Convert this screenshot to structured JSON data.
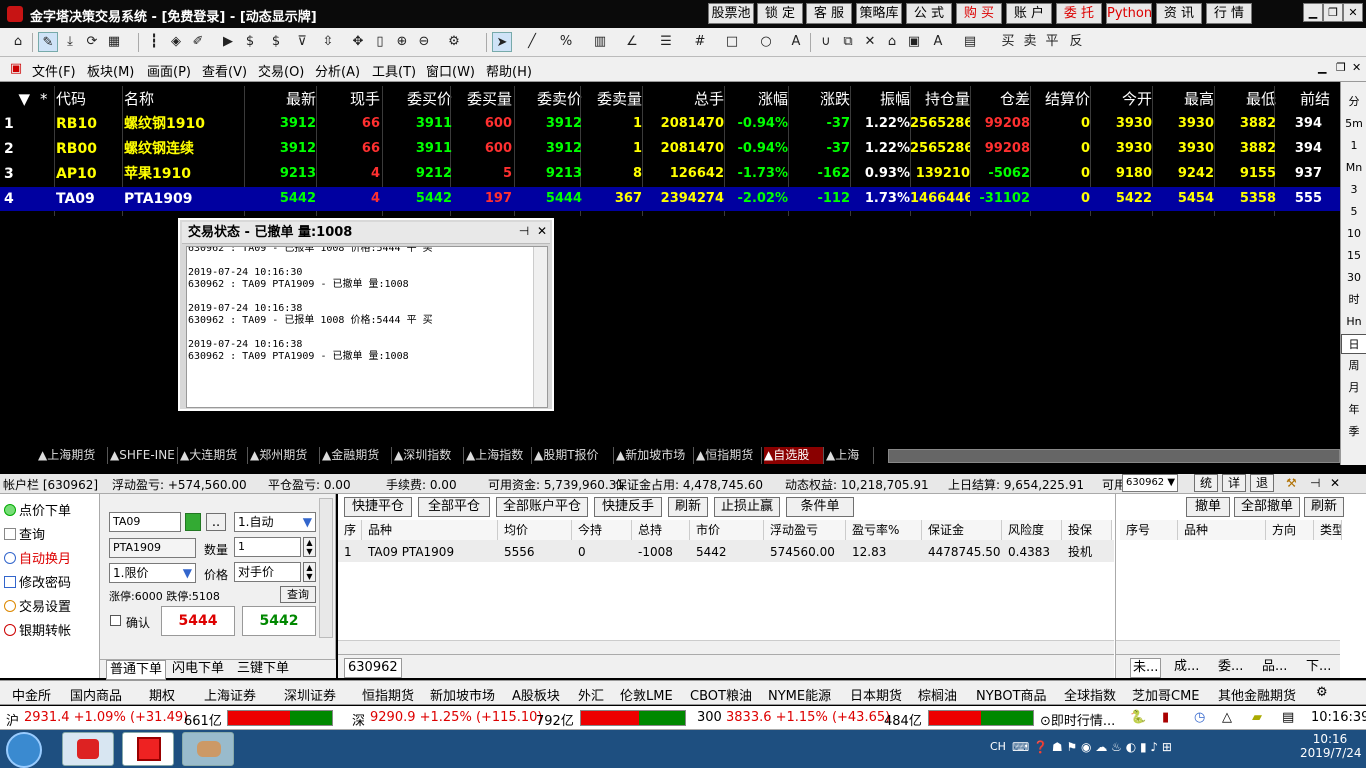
{
  "title": {
    "app": "金字塔决策交易系统",
    "login": "[免费登录]",
    "mode": "[动态显示牌]"
  },
  "title_buttons": [
    {
      "label": "股票池",
      "red": false
    },
    {
      "label": "锁 定",
      "red": false
    },
    {
      "label": "客 服",
      "red": false
    },
    {
      "label": "策略库",
      "red": false
    },
    {
      "label": "公 式",
      "red": false
    },
    {
      "label": "购 买",
      "red": true
    },
    {
      "label": "账 户",
      "red": false
    },
    {
      "label": "委 托",
      "red": true
    },
    {
      "label": "Python",
      "red": true
    },
    {
      "label": "资 讯",
      "red": false
    },
    {
      "label": "行 情",
      "red": false
    }
  ],
  "menu": [
    "文件(F)",
    "板块(M)",
    "画面(P)",
    "查看(V)",
    "交易(O)",
    "分析(A)",
    "工具(T)",
    "窗口(W)",
    "帮助(H)"
  ],
  "quote_headers": [
    "*",
    "代码",
    "名称",
    "最新",
    "现手",
    "委买价",
    "委买量",
    "委卖价",
    "委卖量",
    "总手",
    "涨幅",
    "涨跌",
    "振幅",
    "持仓量",
    "仓差",
    "结算价",
    "今开",
    "最高",
    "最低",
    "前结"
  ],
  "quote_rows": [
    {
      "no": "1",
      "code": "RB10",
      "name": "螺纹钢1910",
      "last": "3912",
      "vol": "66",
      "bid": "3911",
      "bidv": "600",
      "ask": "3912",
      "askv": "1",
      "total": "2081470",
      "chg": "-0.94%",
      "diff": "-37",
      "amp": "1.22%",
      "oi": "2565286",
      "oid": "99208",
      "settle": "0",
      "open": "3930",
      "high": "3930",
      "low": "3882",
      "pre": "394"
    },
    {
      "no": "2",
      "code": "RB00",
      "name": "螺纹钢连续",
      "last": "3912",
      "vol": "66",
      "bid": "3911",
      "bidv": "600",
      "ask": "3912",
      "askv": "1",
      "total": "2081470",
      "chg": "-0.94%",
      "diff": "-37",
      "amp": "1.22%",
      "oi": "2565286",
      "oid": "99208",
      "settle": "0",
      "open": "3930",
      "high": "3930",
      "low": "3882",
      "pre": "394"
    },
    {
      "no": "3",
      "code": "AP10",
      "name": "苹果1910",
      "last": "9213",
      "vol": "4",
      "bid": "9212",
      "bidv": "5",
      "ask": "9213",
      "askv": "8",
      "total": "126642",
      "chg": "-1.73%",
      "diff": "-162",
      "amp": "0.93%",
      "oi": "139210",
      "oid": "-5062",
      "settle": "0",
      "open": "9180",
      "high": "9242",
      "low": "9155",
      "pre": "937"
    },
    {
      "no": "4",
      "code": "TA09",
      "name": "PTA1909",
      "last": "5442",
      "vol": "4",
      "bid": "5442",
      "bidv": "197",
      "ask": "5444",
      "askv": "367",
      "total": "2394274",
      "chg": "-2.02%",
      "diff": "-112",
      "amp": "1.73%",
      "oi": "1466446",
      "oid": "-31102",
      "settle": "0",
      "open": "5422",
      "high": "5454",
      "low": "5358",
      "pre": "555"
    }
  ],
  "popup": {
    "title": "交易状态 - 已撤单 量:1008",
    "log": "630962 : TA09 - 已报单 1008 价格:5444 平 买\n\n2019-07-24 10:16:30\n630962 : TA09 PTA1909 - 已撤单 量:1008\n\n2019-07-24 10:16:38\n630962 : TA09 - 已报单 1008 价格:5444 平 买\n\n2019-07-24 10:16:38\n630962 : TA09 PTA1909 - 已撤单 量:1008"
  },
  "tabs": [
    "▲上海期货",
    "▲SHFE-INE",
    "▲大连期货",
    "▲郑州期货",
    "▲金融期货",
    "▲深圳指数",
    "▲上海指数",
    "▲股期T报价",
    "▲新加坡市场",
    "▲恒指期货",
    "▲自选股",
    "▲上海"
  ],
  "right_side": [
    "分",
    "5m",
    "1",
    "Mn",
    "3",
    "5",
    "10",
    "15",
    "30",
    "时",
    "Hn",
    "日",
    "周",
    "月",
    "年",
    "季"
  ],
  "account": {
    "label": "帐户栏",
    "id": "[630962]",
    "float": "浮动盈亏: +574,560.00",
    "close": "平仓盈亏: 0.00",
    "fee": "手续费: 0.00",
    "avail": "可用资金: 5,739,960.31",
    "margin": "保证金占用: 4,478,745.60",
    "equity": "动态权益: 10,218,705.91",
    "settle": "上日结算: 9,654,225.91",
    "more": "可用",
    "acct_select": "630962",
    "b1": "统",
    "b2": "详",
    "b3": "退"
  },
  "left_nav": [
    "点价下单",
    "查询",
    "自动换月",
    "修改密码",
    "交易设置",
    "银期转帐"
  ],
  "order": {
    "code": "TA09",
    "name": "PTA1909",
    "mode": "1.自动",
    "type": "1.限价",
    "qty_label": "数量",
    "qty": "1",
    "price_label": "价格",
    "price": "对手价",
    "limit_up": "涨停:6000",
    "limit_down": "跌停:5108",
    "query": "查询",
    "confirm": "确认",
    "sell_price": "5444",
    "buy_price": "5442",
    "tabs": [
      "普通下单",
      "闪电下单",
      "三键下单"
    ]
  },
  "pos_buttons": [
    "快捷平仓",
    "全部平仓",
    "全部账户平仓",
    "快捷反手",
    "刷新",
    "止损止赢",
    "条件单"
  ],
  "pos_headers": [
    "序",
    "品种",
    "均价",
    "今持",
    "总持",
    "市价",
    "浮动盈亏",
    "盈亏率%",
    "保证金",
    "风险度",
    "投保"
  ],
  "pos_row": [
    "1",
    "TA09 PTA1909",
    "5556",
    "0",
    "-1008",
    "5442",
    "574560.00",
    "12.83",
    "4478745.50",
    "0.4383",
    "投机"
  ],
  "pos_footer": "630962",
  "ord_buttons": [
    "撤单",
    "全部撤单",
    "刷新"
  ],
  "ord_headers": [
    "序号",
    "品种",
    "方向",
    "类型"
  ],
  "ord_tabs": [
    "未...",
    "成...",
    "委...",
    "品...",
    "下..."
  ],
  "markets": [
    "中金所",
    "国内商品",
    "期权",
    "上海证券",
    "深圳证券",
    "恒指期货",
    "新加坡市场",
    "A股板块",
    "外汇",
    "伦敦LME",
    "CBOT粮油",
    "NYME能源",
    "日本期货",
    "棕榈油",
    "NYBOT商品",
    "全球指数",
    "芝加哥CME",
    "其他金融期货"
  ],
  "index": {
    "sh_label": "沪",
    "sh_val": "2931.4 +1.09% (+31.49)",
    "sh_amt": "661亿",
    "sz_label": "深",
    "sz_val": "9290.9 +1.25% (+115.10)",
    "sz_amt": "792亿",
    "c3_label": "300",
    "c3_val": "3833.6 +1.15% (+43.65)",
    "c3_amt": "484亿",
    "live": "即时行情...",
    "time": "10:16:39"
  },
  "taskbar": {
    "lang": "CH",
    "time": "10:16",
    "date": "2019/7/24"
  }
}
